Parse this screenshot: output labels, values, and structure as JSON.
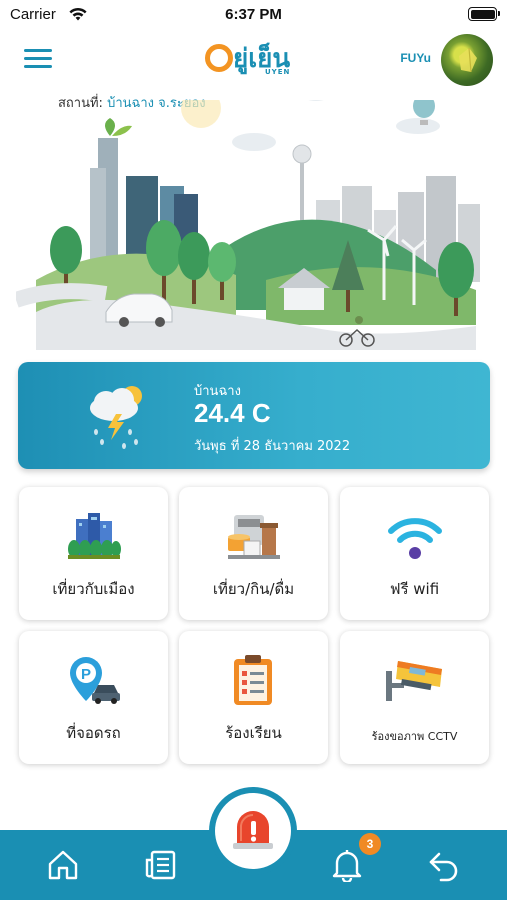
{
  "status_bar": {
    "carrier": "Carrier",
    "time": "6:37 PM"
  },
  "header": {
    "logo_text": "ยู่เย็น",
    "logo_sub": "UYEN",
    "username": "FUYu"
  },
  "location": {
    "label": "สถานที่:",
    "place": "บ้านฉาง จ.ระยอง"
  },
  "weather": {
    "place": "บ้านฉาง",
    "temperature": "24.4 C",
    "date": "วันพุธ ที่ 28 ธันวาคม 2022",
    "icon": "thunderstorm-rain-icon"
  },
  "tiles": [
    {
      "label": "เที่ยวกับเมือง",
      "icon": "city-buildings-icon"
    },
    {
      "label": "เที่ยว/กิน/ดื่ม",
      "icon": "cafe-icon"
    },
    {
      "label": "ฟรี wifi",
      "icon": "wifi-icon"
    },
    {
      "label": "ที่จอดรถ",
      "icon": "parking-icon"
    },
    {
      "label": "ร้องเรียน",
      "icon": "clipboard-icon"
    },
    {
      "label": "ร้องขอภาพ CCTV",
      "icon": "cctv-camera-icon"
    }
  ],
  "bottom_nav": {
    "items": [
      "home-icon",
      "news-icon",
      "emergency-siren-icon",
      "notification-bell-icon",
      "back-icon"
    ],
    "notification_count": "3"
  },
  "colors": {
    "primary": "#1a8fb3",
    "accent": "#f39422",
    "badge": "#f08a24"
  }
}
